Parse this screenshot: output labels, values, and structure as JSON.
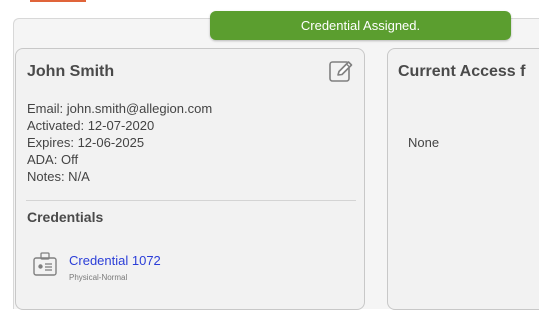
{
  "toast": {
    "message": "Credential Assigned."
  },
  "user_card": {
    "name": "John Smith",
    "email": "Email: john.smith@allegion.com",
    "activated": "Activated: 12-07-2020",
    "expires": "Expires: 12-06-2025",
    "ada": "ADA: Off",
    "notes": "Notes: N/A",
    "credentials_title": "Credentials",
    "credentials": [
      {
        "label": "Credential 1072",
        "type": "Physical-Normal"
      }
    ]
  },
  "access_card": {
    "title": "Current Access f",
    "empty_text": "None"
  },
  "colors": {
    "toast_bg": "#5b9e2f",
    "link": "#2b3ed8",
    "accent": "#e0643a"
  },
  "icons": {
    "edit": "edit-icon",
    "credential": "badge-icon"
  }
}
